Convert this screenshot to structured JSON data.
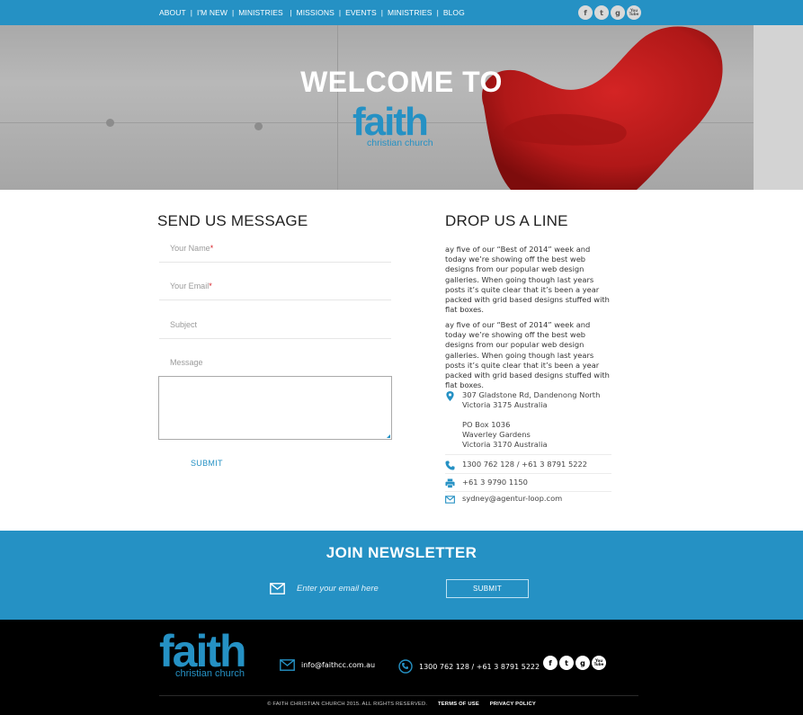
{
  "nav": {
    "items": [
      "ABOUT",
      "I'M NEW",
      "MINISTRIES ",
      "MISSIONS",
      "EVENTS",
      "MINISTRIES",
      "BLOG"
    ]
  },
  "social": {
    "top": [
      "f",
      "t",
      "g",
      "You Tube"
    ],
    "footer": [
      "f",
      "t",
      "g",
      "You Tube"
    ]
  },
  "hero": {
    "title": "WELCOME TO",
    "logo_word": "faith",
    "logo_sub": "christian church"
  },
  "contact_form": {
    "heading": "SEND US MESSAGE",
    "name_placeholder": "Your Name",
    "email_placeholder": "Your Email",
    "required_mark": "*",
    "subject_placeholder": "Subject",
    "message_placeholder": "Message",
    "submit_label": "SUBMIT"
  },
  "drop_line": {
    "heading": "DROP US A LINE",
    "paragraph1": "ay five of our “Best of 2014” week and today we’re showing off the best web designs from our popular web design galleries. When going though last years posts it’s quite clear that it’s been a year packed with grid based designs stuffed with flat boxes.",
    "paragraph2": "ay five of our “Best of 2014” week and today we’re showing off the best web designs from our popular web design galleries. When going though last years posts it’s quite clear that it’s been a year packed with grid based designs stuffed with flat boxes.",
    "address_line1": "307 Gladstone Rd, Dandenong North",
    "address_line2": "Victoria 3175 Australia",
    "pobox_line1": "PO Box 1036",
    "pobox_line2": "Waverley Gardens",
    "pobox_line3": "Victoria 3170 Australia",
    "phone": "1300 762 128 / +61  3 8791 5222",
    "fax": "+61 3 9790 1150",
    "email": "sydney@agentur-loop.com"
  },
  "newsletter": {
    "title": "JOIN NEWSLETTER",
    "email_placeholder": "Enter your email here",
    "submit_label": "SUBMIT"
  },
  "footer": {
    "logo_word": "faith",
    "logo_sub": "christian church",
    "email": "info@faithcc.com.au",
    "phone": "1300 762 128 / +61 3 8791 5222",
    "copyright": "© FAITH CHRISTIAN CHURCH 2015. ALL RIGHTS RESERVED.",
    "terms": "TERMS OF USE",
    "privacy": "PRIVACY POLICY"
  },
  "colors": {
    "brand_blue": "#2591c4",
    "chair_red": "#c81e1e",
    "footer_bg": "#000000"
  },
  "icons": [
    "facebook-icon",
    "twitter-icon",
    "google-plus-icon",
    "youtube-icon",
    "map-pin-icon",
    "phone-icon",
    "printer-icon",
    "envelope-icon"
  ]
}
